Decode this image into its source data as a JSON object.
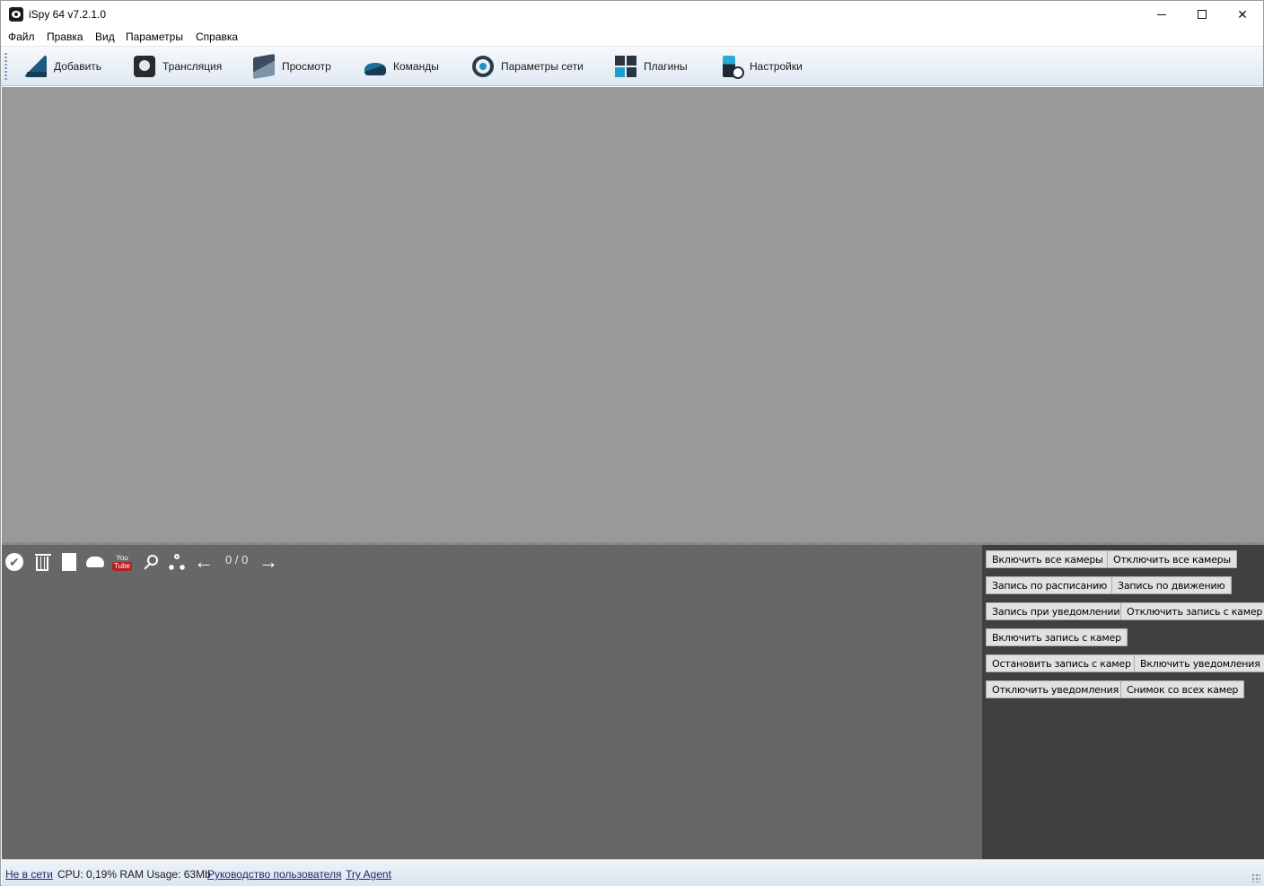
{
  "window": {
    "title": "iSpy 64 v7.2.1.0",
    "controls": {
      "minimize": "",
      "maximize": "",
      "close": "✕"
    }
  },
  "menu": [
    "Файл",
    "Правка",
    "Вид",
    "Параметры",
    "Справка"
  ],
  "toolbar": [
    {
      "label": "Добавить",
      "icon": "add-icon"
    },
    {
      "label": "Трансляция",
      "icon": "stream-icon"
    },
    {
      "label": "Просмотр",
      "icon": "view-icon"
    },
    {
      "label": "Команды",
      "icon": "commands-icon"
    },
    {
      "label": "Параметры сети",
      "icon": "network-icon"
    },
    {
      "label": "Плагины",
      "icon": "plugins-icon"
    },
    {
      "label": "Настройки",
      "icon": "settings-icon"
    }
  ],
  "media_panel": {
    "icons": [
      "check-icon",
      "trash-icon",
      "book-icon",
      "cloud-upload-icon",
      "youtube-icon",
      "search-icon",
      "tree-icon",
      "arrow-left-icon",
      "arrow-right-icon"
    ],
    "youtube_top": "You",
    "youtube_bottom": "Tube",
    "page_count": "0 / 0",
    "arrow_left": "←",
    "arrow_right": "→",
    "check": "✔"
  },
  "camera_buttons": [
    "Включить все камеры",
    "Отключить все камеры",
    "Запись по расписанию",
    "Запись по движению",
    "Запись при уведомлении",
    "Отключить запись с камер",
    "Включить запись с камер",
    "Остановить запись с камер",
    "Включить  уведомления",
    "Отключить уведомления",
    "Снимок со всех камер"
  ],
  "status": {
    "connection": "Не в сети",
    "usage": "CPU: 0,19% RAM Usage: 63Mb",
    "guide_link": "Руководство пользователя",
    "agent_link": "Try Agent"
  },
  "colors": {
    "camera_area": "#999999",
    "media_panel": "#676767",
    "button_panel": "#404040"
  }
}
